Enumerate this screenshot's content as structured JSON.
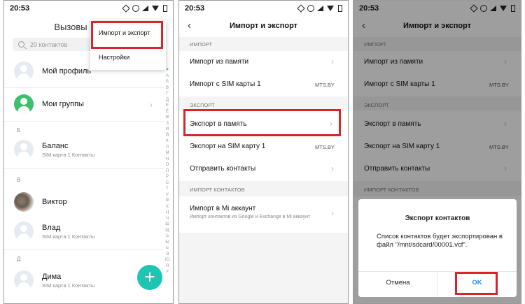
{
  "status": {
    "time": "20:53"
  },
  "colors": {
    "accent_red": "#d9242b",
    "fab": "#20c4b2",
    "green": "#3dbf6d",
    "ok_blue": "#1e90ff"
  },
  "contacts_screen": {
    "title": "Вызовы",
    "search_placeholder": "20 контактов",
    "menu": [
      "Импорт и экспорт",
      "Настройки"
    ],
    "my_profile": "Мой профиль",
    "my_groups": "Мои группы",
    "sections": [
      {
        "letter": "Б",
        "items": [
          {
            "name": "Баланс",
            "sub": "SIM карта 1 Контакты"
          }
        ]
      },
      {
        "letter": "В",
        "items": [
          {
            "name": "Виктор",
            "sub": ""
          },
          {
            "name": "Влад",
            "sub": "SIM карта 1 Контакты"
          }
        ]
      },
      {
        "letter": "Д",
        "items": [
          {
            "name": "Дима",
            "sub": "SIM карта 1 Контакты"
          }
        ]
      }
    ],
    "alphabet": [
      "♥",
      "А",
      "Б",
      "В",
      "Г",
      "Д",
      "Е",
      "Ё",
      "Ж",
      "З",
      "И",
      "Й",
      "К",
      "Л",
      "М",
      "Н",
      "О",
      "П",
      "Р",
      "С",
      "Т",
      "У",
      "Ф",
      "Х",
      "Ц",
      "Ч",
      "Ш",
      "Щ",
      "Ъ",
      "Ы",
      "Ь",
      "Э",
      "Ю",
      "Я",
      "#"
    ],
    "fab": "+"
  },
  "import_export": {
    "title": "Импорт и экспорт",
    "section_import": "ИМПОРТ",
    "import_memory": "Импорт из памяти",
    "import_sim": "Импорт с SIM карты 1",
    "sim_value": "MTS.BY",
    "section_export": "ЭКСПОРТ",
    "export_memory": "Экспорт в память",
    "export_sim": "Экспорт на SIM карту 1",
    "send_contacts": "Отправить контакты",
    "section_import_contacts": "ИМПОРТ КОНТАКТОВ",
    "import_mi": "Импорт в Mi аккаунт",
    "import_mi_sub": "Импорт контактов из Google и Exchange в Mi аккаунт"
  },
  "dialog": {
    "title": "Экспорт контактов",
    "body": "Список контактов будет экспортирован в файл \"/mnt/sdcard/00001.vcf\".",
    "cancel": "Отмена",
    "ok": "OK"
  }
}
